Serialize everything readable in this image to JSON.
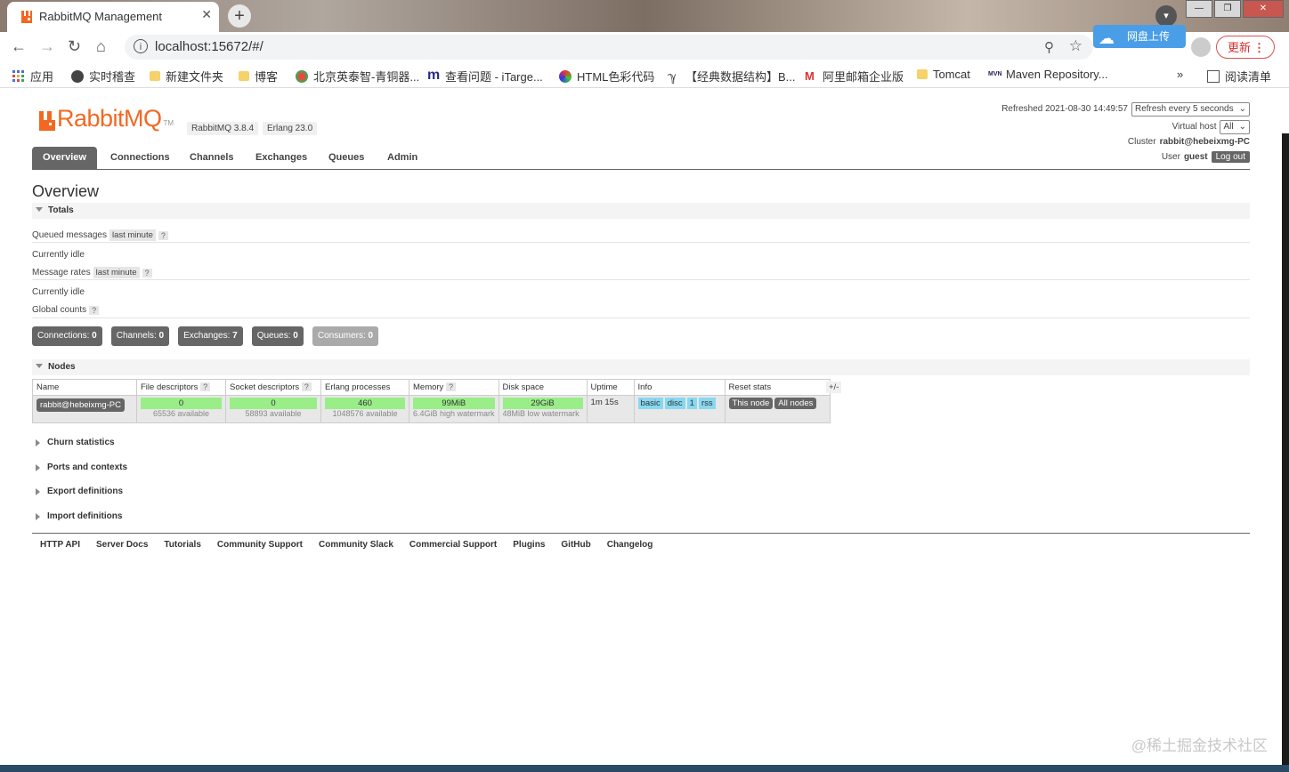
{
  "browser": {
    "tab_title": "RabbitMQ Management",
    "tab_close": "✕",
    "new_tab": "+",
    "url": "localhost:15672/#/",
    "ext_label": "网盘上传",
    "update_label": "更新",
    "bookmarks": [
      {
        "label": "应用",
        "icon": "apps-grid-icon"
      },
      {
        "label": "实时稽查",
        "icon": "globe-icon"
      },
      {
        "label": "新建文件夹",
        "icon": "folder-icon"
      },
      {
        "label": "博客",
        "icon": "folder-icon"
      },
      {
        "label": "北京英泰智-青铜器...",
        "icon": "site-icon"
      },
      {
        "label": "查看问题 - iTarge...",
        "icon": "site-icon"
      },
      {
        "label": "HTML色彩代码",
        "icon": "site-icon"
      },
      {
        "label": "【经典数据结构】B...",
        "icon": "site-icon"
      },
      {
        "label": "阿里邮箱企业版",
        "icon": "mail-icon"
      },
      {
        "label": "Tomcat",
        "icon": "folder-icon"
      },
      {
        "label": "Maven Repository...",
        "icon": "site-icon"
      }
    ],
    "more_bookmarks": "»",
    "reading_list": "阅读清单"
  },
  "header": {
    "logo_text": "RabbitMQ",
    "logo_tm": "TM",
    "rabbitmq_version": "RabbitMQ 3.8.4",
    "erlang_version": "Erlang 23.0",
    "refreshed_label": "Refreshed 2021-08-30 14:49:57",
    "refresh_select": "Refresh every 5 seconds",
    "virtual_host_label": "Virtual host",
    "virtual_host_value": "All",
    "cluster_label": "Cluster",
    "cluster_value": "rabbit@hebeixmg-PC",
    "user_label": "User",
    "user_value": "guest",
    "logout_label": "Log out"
  },
  "nav": [
    "Overview",
    "Connections",
    "Channels",
    "Exchanges",
    "Queues",
    "Admin"
  ],
  "page_title": "Overview",
  "totals": {
    "title": "Totals",
    "queued_messages": "Queued messages",
    "message_rates": "Message rates",
    "last_minute": "last minute",
    "help": "?",
    "currently_idle": "Currently idle",
    "global_counts": "Global counts"
  },
  "counts": [
    {
      "label": "Connections:",
      "value": "0"
    },
    {
      "label": "Channels:",
      "value": "0"
    },
    {
      "label": "Exchanges:",
      "value": "7"
    },
    {
      "label": "Queues:",
      "value": "0"
    },
    {
      "label": "Consumers:",
      "value": "0"
    }
  ],
  "nodes": {
    "title": "Nodes",
    "headers": [
      "Name",
      "File descriptors",
      "Socket descriptors",
      "Erlang processes",
      "Memory",
      "Disk space",
      "Uptime",
      "Info",
      "Reset stats"
    ],
    "row": {
      "name": "rabbit@hebeixmg-PC",
      "fd_used": "0",
      "fd_avail": "65536 available",
      "sd_used": "0",
      "sd_avail": "58893 available",
      "erl_used": "460",
      "erl_avail": "1048576 available",
      "mem_used": "99MiB",
      "mem_sub": "6.4GiB high watermark",
      "disk_used": "29GiB",
      "disk_sub": "48MiB low watermark",
      "uptime": "1m 15s",
      "info": [
        "basic",
        "disc",
        "1",
        "rss"
      ],
      "reset_this": "This node",
      "reset_all": "All nodes"
    },
    "plus_minus": "+/-"
  },
  "collapsed_sections": [
    "Churn statistics",
    "Ports and contexts",
    "Export definitions",
    "Import definitions"
  ],
  "footer_links": [
    "HTTP API",
    "Server Docs",
    "Tutorials",
    "Community Support",
    "Community Slack",
    "Commercial Support",
    "Plugins",
    "GitHub",
    "Changelog"
  ],
  "watermark": "@稀土掘金技术社区",
  "colors": {
    "brand": "#f26822",
    "nav_active": "#666666",
    "bar_green": "#99ee88",
    "info_blue": "#88d8f0"
  }
}
